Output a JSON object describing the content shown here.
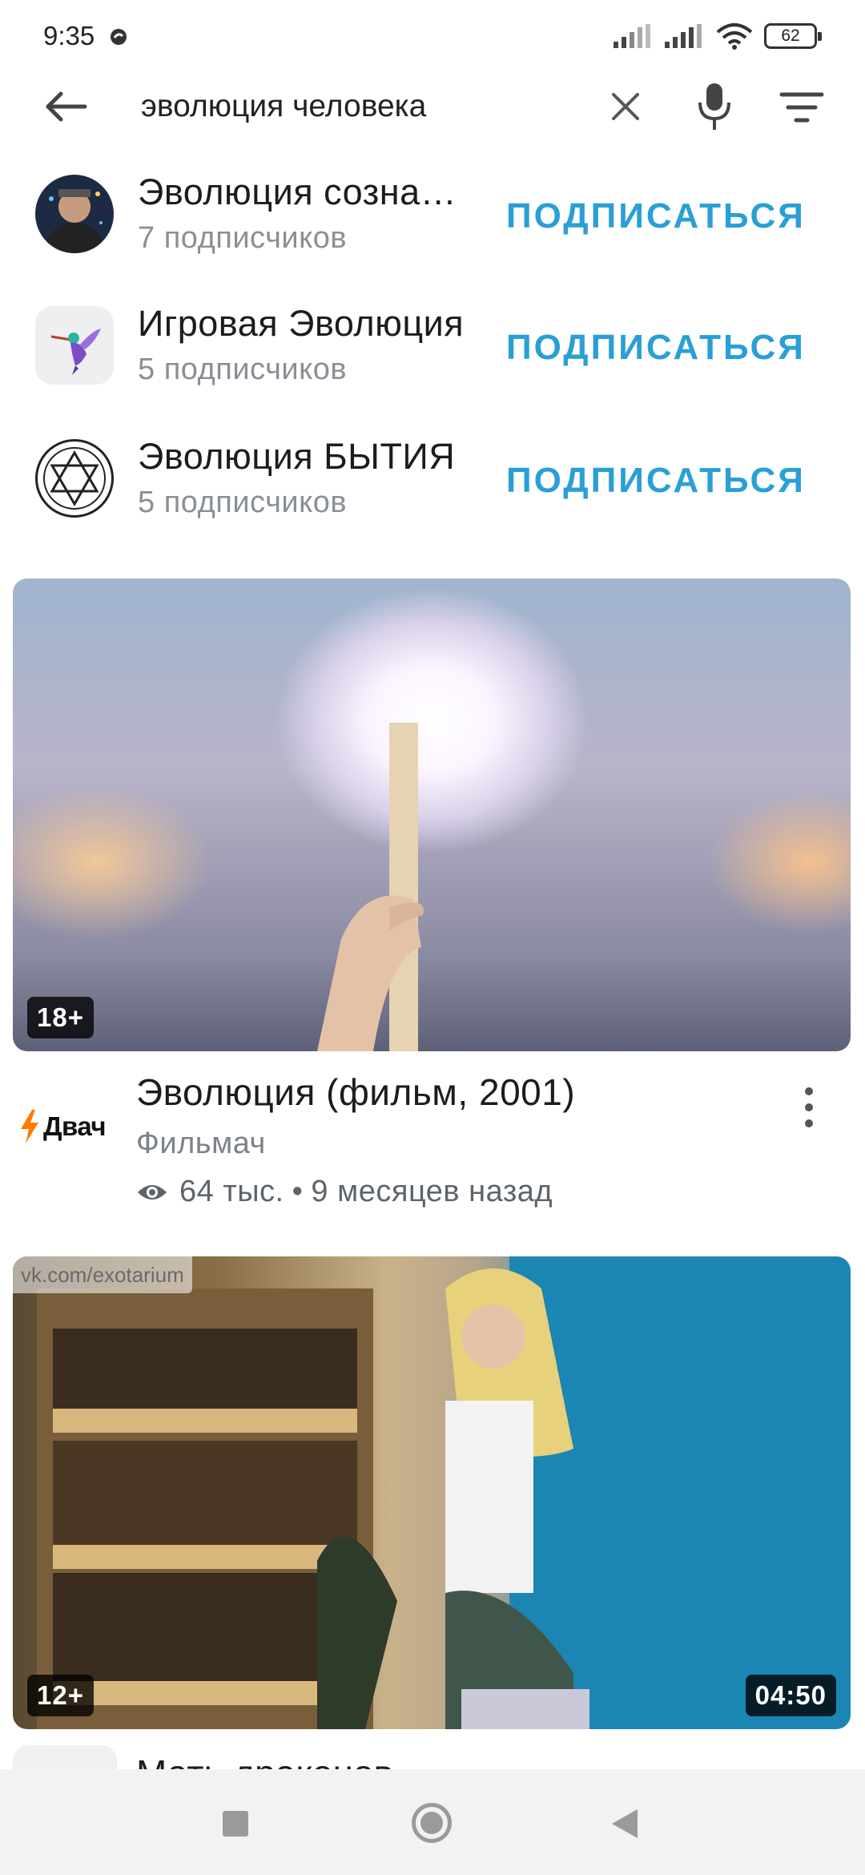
{
  "status_bar": {
    "time": "9:35",
    "battery": "62"
  },
  "search": {
    "query": "эволюция человека"
  },
  "communities": [
    {
      "name": "Эволюция сознания",
      "subscribers": "7 подписчиков",
      "action": "ПОДПИСАТЬСЯ"
    },
    {
      "name": "Игровая Эволюция",
      "subscribers": "5 подписчиков",
      "action": "ПОДПИСАТЬСЯ"
    },
    {
      "name": "Эволюция БЫТИЯ",
      "subscribers": "5 подписчиков",
      "action": "ПОДПИСАТЬСЯ"
    }
  ],
  "videos": [
    {
      "age_rating": "18+",
      "channel_logo": "Двач",
      "title": "Эволюция (фильм, 2001)",
      "channel": "Фильмач",
      "views": "64 тыс.",
      "separator": "•",
      "date": "9 месяцев назад"
    },
    {
      "watermark": "vk.com/exotarium",
      "age_rating": "12+",
      "duration": "04:50",
      "title": "Мать драконов"
    }
  ],
  "colors": {
    "accent": "#2a9fd6",
    "secondary_text": "#8a8f96"
  }
}
